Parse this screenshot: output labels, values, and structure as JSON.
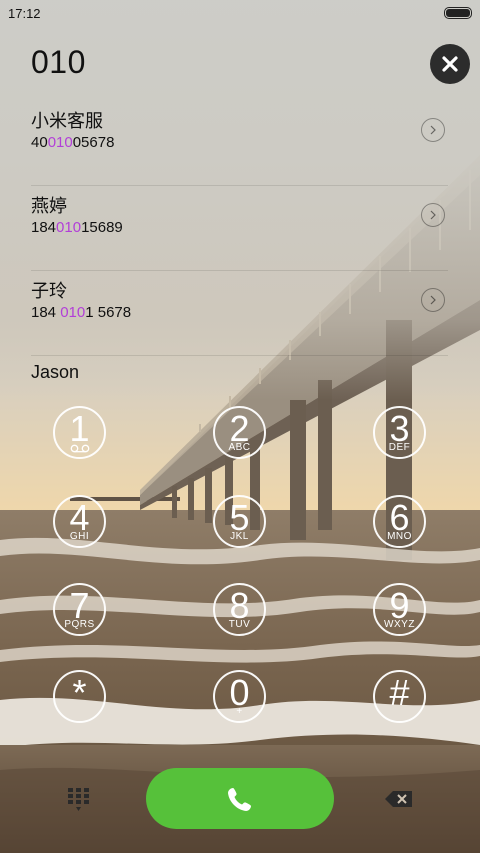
{
  "status_bar": {
    "time": "17:12"
  },
  "search": {
    "query": "010"
  },
  "results": [
    {
      "name": "小米客服",
      "number_pre": "40",
      "number_hl": "010",
      "number_post": "05678"
    },
    {
      "name": "燕婷",
      "number_pre": "184",
      "number_hl": "010",
      "number_post": "15689"
    },
    {
      "name": "子玲",
      "number_pre": "184 ",
      "number_hl": "010",
      "number_post": "1 5678"
    },
    {
      "name": "Jason"
    }
  ],
  "keypad": [
    {
      "digit": "1",
      "letters": ""
    },
    {
      "digit": "2",
      "letters": "ABC"
    },
    {
      "digit": "3",
      "letters": "DEF"
    },
    {
      "digit": "4",
      "letters": "GHI"
    },
    {
      "digit": "5",
      "letters": "JKL"
    },
    {
      "digit": "6",
      "letters": "MNO"
    },
    {
      "digit": "7",
      "letters": "PQRS"
    },
    {
      "digit": "8",
      "letters": "TUV"
    },
    {
      "digit": "9",
      "letters": "WXYZ"
    },
    {
      "digit": "*",
      "letters": ""
    },
    {
      "digit": "0",
      "letters": "+"
    },
    {
      "digit": "#",
      "letters": ""
    }
  ],
  "colors": {
    "highlight": "#b23fd8",
    "call_button": "#56c13a"
  },
  "icons": {
    "clear": "close-icon",
    "chevron": "chevron-right-icon",
    "voicemail": "voicemail-icon",
    "dialpad": "dialpad-icon",
    "call": "phone-icon",
    "backspace": "backspace-icon"
  }
}
